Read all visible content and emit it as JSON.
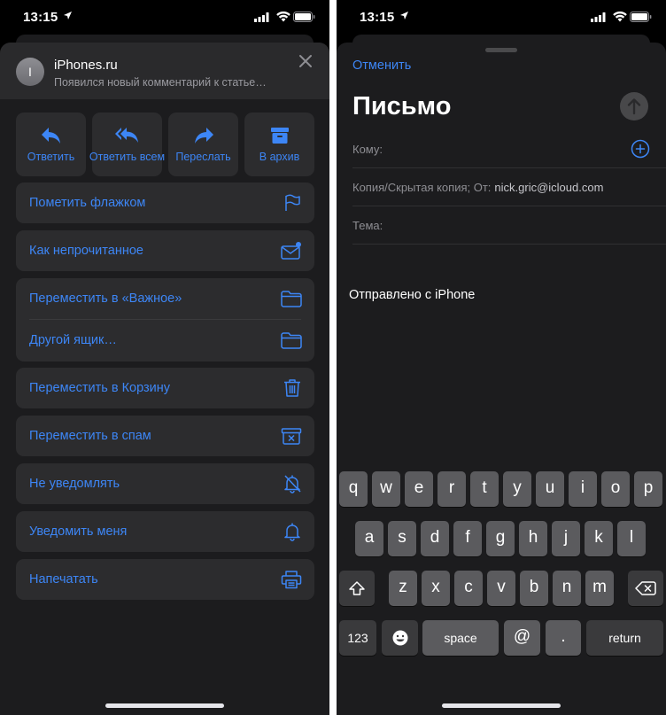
{
  "status": {
    "time": "13:15"
  },
  "left": {
    "header": {
      "avatar_initial": "I",
      "sender": "iPhones.ru",
      "preview": "Появился новый комментарий к статье…"
    },
    "actions": [
      {
        "name": "reply",
        "label": "Ответить",
        "icon": "reply-icon"
      },
      {
        "name": "reply-all",
        "label": "Ответить всем",
        "icon": "reply-all-icon"
      },
      {
        "name": "forward",
        "label": "Переслать",
        "icon": "forward-icon"
      },
      {
        "name": "archive",
        "label": "В архив",
        "icon": "archive-icon"
      }
    ],
    "menu": {
      "flag": "Пометить флажком",
      "unread": "Как непрочитанное",
      "move_important": "Переместить в «Важное»",
      "other_box": "Другой ящик…",
      "trash": "Переместить в Корзину",
      "spam": "Переместить в спам",
      "mute": "Не уведомлять",
      "notify": "Уведомить меня",
      "print": "Напечатать"
    }
  },
  "right": {
    "cancel": "Отменить",
    "title": "Письмо",
    "to_label": "Кому:",
    "cc_label": "Копия/Скрытая копия; От:",
    "from_value": "nick.gric@icloud.com",
    "subject_label": "Тема:",
    "signature": "Отправлено с iPhone"
  },
  "keyboard": {
    "row1": [
      "q",
      "w",
      "e",
      "r",
      "t",
      "y",
      "u",
      "i",
      "o",
      "p"
    ],
    "row2": [
      "a",
      "s",
      "d",
      "f",
      "g",
      "h",
      "j",
      "k",
      "l"
    ],
    "row3": [
      "z",
      "x",
      "c",
      "v",
      "b",
      "n",
      "m"
    ],
    "numbers": "123",
    "space": "space",
    "at": "@",
    "dot": ".",
    "return": "return"
  },
  "colors": {
    "accent": "#3d86f6",
    "sheet": "#1c1c1e",
    "tile": "#2c2c2e",
    "key": "#5b5b5e",
    "key_dark": "#3a3a3c"
  }
}
